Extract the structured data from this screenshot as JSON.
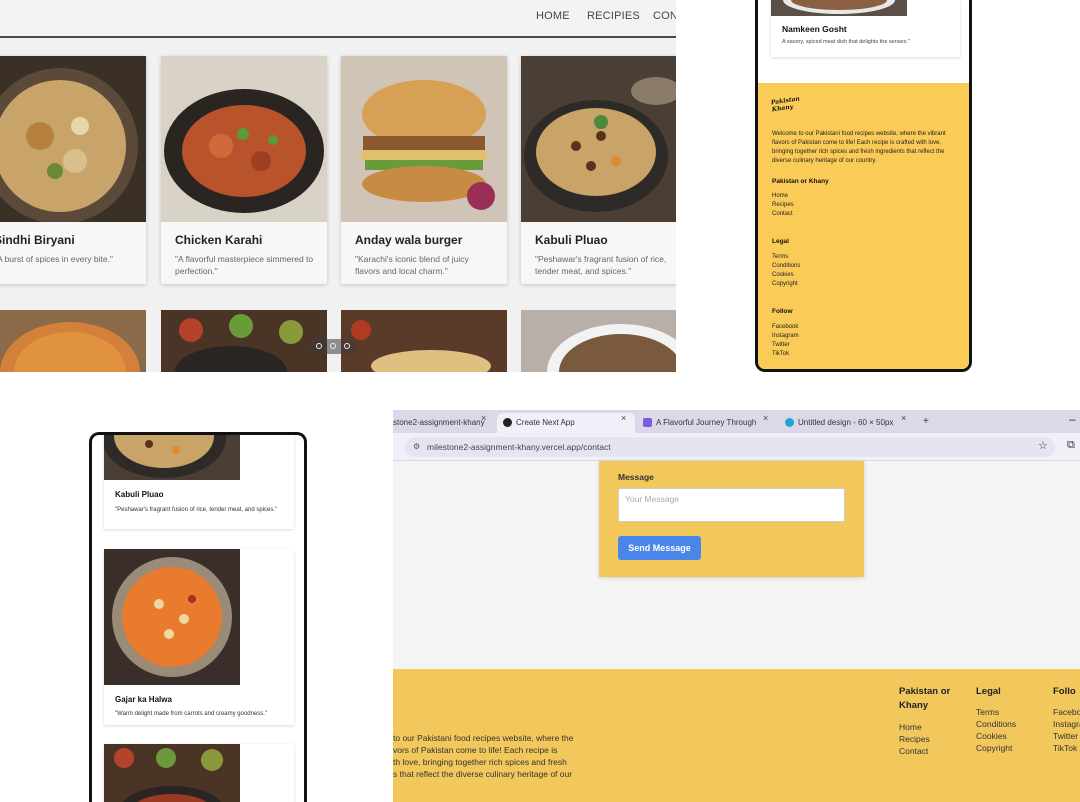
{
  "desktop": {
    "nav": [
      "HOME",
      "RECIPIES",
      "CONT"
    ],
    "cards": [
      {
        "title": "Sindhi Biryani",
        "desc": "\"A burst of spices in every bite.\""
      },
      {
        "title": "Chicken Karahi",
        "desc": "\"A flavorful masterpiece simmered to perfection.\""
      },
      {
        "title": "Anday wala burger",
        "desc": "\"Karachi's iconic blend of juicy flavors and local charm.\""
      },
      {
        "title": "Kabuli Pluao",
        "desc": "\"Peshawar's fragrant fusion of rice, tender meat, and spices.\""
      }
    ]
  },
  "phone_footer": {
    "card_title": "Namkeen Gosht",
    "card_desc": "A savory, spiced meat dish that delights the senses.\"",
    "logo": "Pakistan Khany",
    "about": "Welcome to our Pakistani food recipes website, where the vibrant flavors of Pakistan come to life! Each recipe is crafted with love, bringing together rich spices and fresh ingredients that reflect the diverse culinary heritage of our country.",
    "sections": [
      {
        "heading": "Pakistan or Khany",
        "links": [
          "Home",
          "Recipes",
          "Contact"
        ]
      },
      {
        "heading": "Legal",
        "links": [
          "Terms",
          "Conditions",
          "Cookies",
          "Copyright"
        ]
      },
      {
        "heading": "Follow",
        "links": [
          "Facebook",
          "Instagram",
          "Twitter",
          "TikTok"
        ]
      }
    ]
  },
  "phone_recipes": {
    "cards": [
      {
        "title": "Kabuli Pluao",
        "desc": "\"Peshawar's fragrant fusion of rice, tender meat, and spices.\""
      },
      {
        "title": "Gajar ka Halwa",
        "desc": "\"Warm delight made from carrots and creamy goodness.\""
      }
    ]
  },
  "browser": {
    "tabs": [
      {
        "label": "stone2-assignment-khany"
      },
      {
        "label": "Create Next App"
      },
      {
        "label": "A Flavorful Journey Through"
      },
      {
        "label": "Untitled design - 60 × 50px"
      }
    ],
    "new_tab": "+",
    "url": "milestone2-assignment-khany.vercel.app/contact",
    "message_label": "Message",
    "message_placeholder": "Your Message",
    "send_label": "Send Message",
    "footer_about": [
      "to our Pakistani food recipes website, where the",
      "vors of Pakistan come to life! Each recipe is",
      "th love, bringing together rich spices and fresh",
      "s that reflect the diverse culinary heritage of our"
    ],
    "footer_cols": [
      {
        "heading_lines": [
          "Pakistan or",
          "Khany"
        ],
        "links": [
          "Home",
          "Recipes",
          "Contact"
        ]
      },
      {
        "heading_lines": [
          "Legal"
        ],
        "links": [
          "Terms",
          "Conditions",
          "Cookies",
          "Copyright"
        ]
      },
      {
        "heading_lines": [
          "Follo"
        ],
        "links": [
          "Facebo",
          "Instagra",
          "Twitter",
          "TikTok"
        ]
      }
    ]
  },
  "colors": {
    "accent_yellow": "#f2c85d",
    "send_blue": "#4a86e8"
  }
}
